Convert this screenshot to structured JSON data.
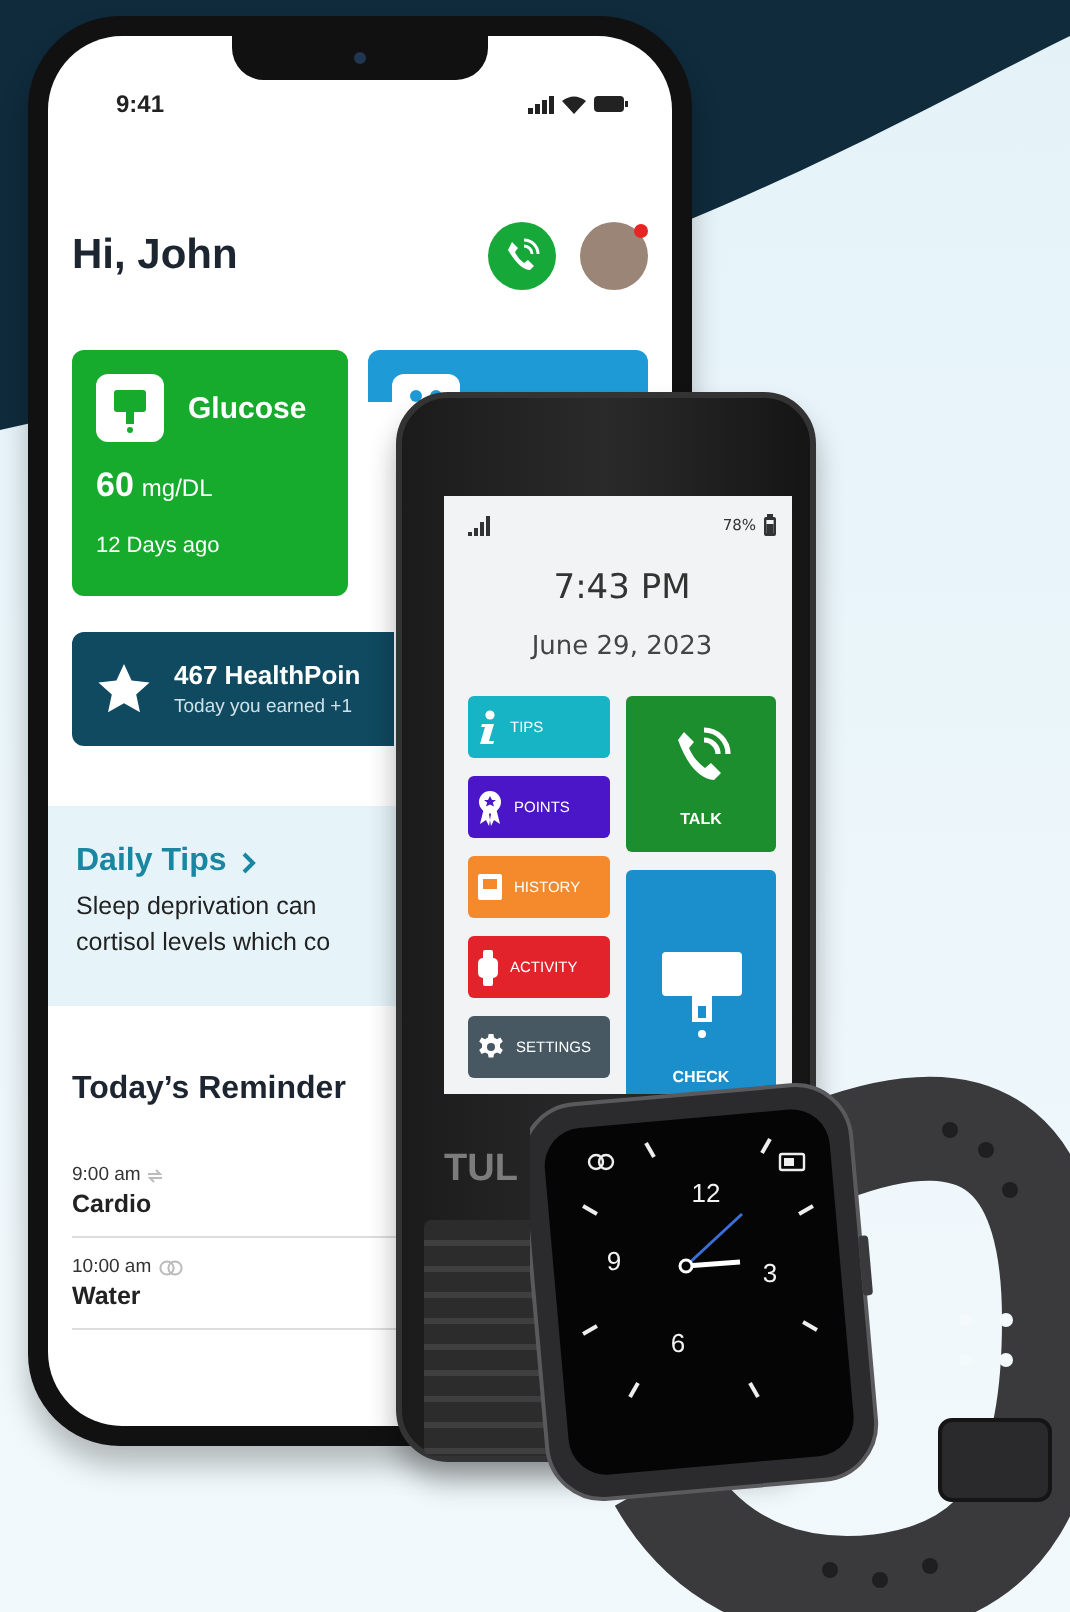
{
  "phone": {
    "status_bar": {
      "time": "9:41"
    },
    "greeting": "Hi, John",
    "glucose_card": {
      "title": "Glucose",
      "value": "60",
      "unit": "mg/DL",
      "note": "12 Days ago"
    },
    "points_banner": {
      "title": "467 HealthPoin",
      "subtitle": "Today you earned +1"
    },
    "daily_tips": {
      "title": "Daily Tips",
      "lines": [
        "Sleep deprivation can",
        "cortisol levels which co"
      ]
    },
    "reminders": {
      "title": "Today’s Reminder",
      "items": [
        {
          "kind": "repeat",
          "time": "9:00 am",
          "label": "Cardio"
        },
        {
          "kind": "rings",
          "time": "10:00 am",
          "label": "Water"
        }
      ]
    }
  },
  "tablet": {
    "battery": "78%",
    "time": "7:43 PM",
    "date": "June 29, 2023",
    "menu": [
      {
        "kind": "tips",
        "label": "TIPS",
        "color": "#16b4c4"
      },
      {
        "kind": "points",
        "label": "POINTS",
        "color": "#4a16c8"
      },
      {
        "kind": "history",
        "label": "HISTORY",
        "color": "#f48a2c"
      },
      {
        "kind": "activity",
        "label": "ACTIVITY",
        "color": "#e2232b"
      },
      {
        "kind": "settings",
        "label": "SETTINGS",
        "color": "#475863"
      }
    ],
    "tiles": [
      {
        "kind": "talk",
        "label": "TALK",
        "color": "#1d8e2d"
      },
      {
        "kind": "check",
        "label": "CHECK",
        "color": "#1a8fcc"
      }
    ],
    "brand": "TUL"
  },
  "watch": {
    "numerals": [
      "12",
      "3",
      "6",
      "9"
    ]
  }
}
